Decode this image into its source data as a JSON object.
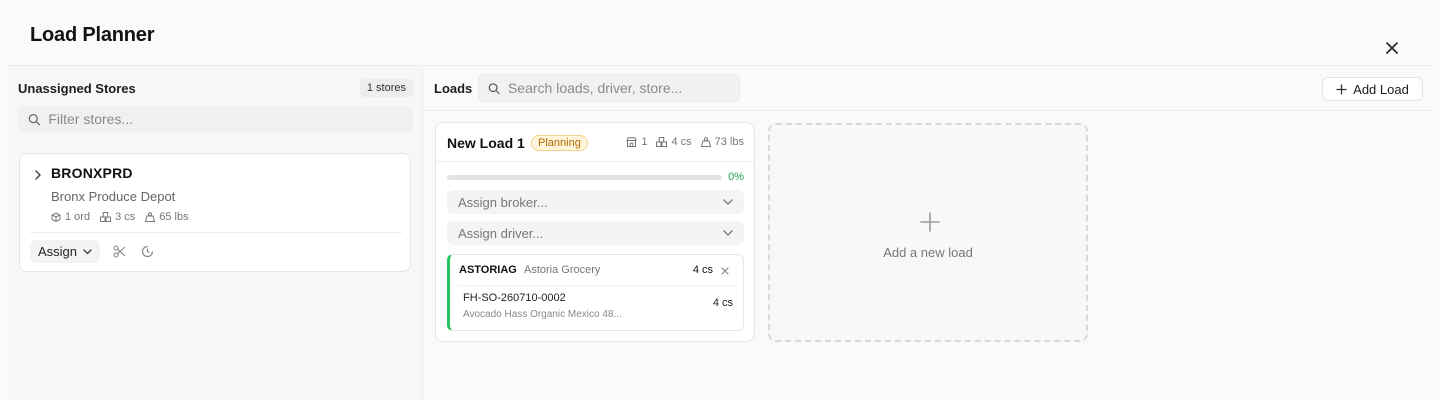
{
  "dialog": {
    "title": "Load Planner"
  },
  "unassigned": {
    "title": "Unassigned Stores",
    "count": "1 stores",
    "filter_placeholder": "Filter stores...",
    "stores": [
      {
        "code": "BRONXPRD",
        "name": "Bronx Produce Depot",
        "orders": "1 ord",
        "cases": "3 cs",
        "weight": "65 lbs",
        "assign_label": "Assign"
      }
    ]
  },
  "loads_toolbar": {
    "label": "Loads",
    "search_placeholder": "Search loads, driver, store...",
    "add_load_label": "Add Load"
  },
  "loads": [
    {
      "title": "New Load 1",
      "status": "Planning",
      "stores": "1",
      "cases": "4 cs",
      "weight": "73 lbs",
      "progress": 0,
      "progress_label": "0%",
      "broker_placeholder": "Assign broker...",
      "driver_placeholder": "Assign driver...",
      "stops": [
        {
          "code": "ASTORIAG",
          "name": "Astoria Grocery",
          "cases": "4 cs",
          "order_no": "FH-SO-260710-0002",
          "order_item": "Avocado Hass Organic Mexico 48...",
          "order_cases": "4 cs"
        }
      ]
    }
  ],
  "add_new_load": {
    "label": "Add a new load"
  },
  "colors": {
    "status_bg": "#fff4dc",
    "status_text": "#b46a00",
    "stop_accent": "#22c55e",
    "pct_green": "#1ea35a"
  },
  "icons": [
    "close-icon",
    "search-icon",
    "chevron-right-icon",
    "box-icon",
    "boxes-icon",
    "weight-icon",
    "chevron-down-icon",
    "scissors-icon",
    "clock-icon",
    "plus-icon",
    "store-icon",
    "x-icon"
  ]
}
